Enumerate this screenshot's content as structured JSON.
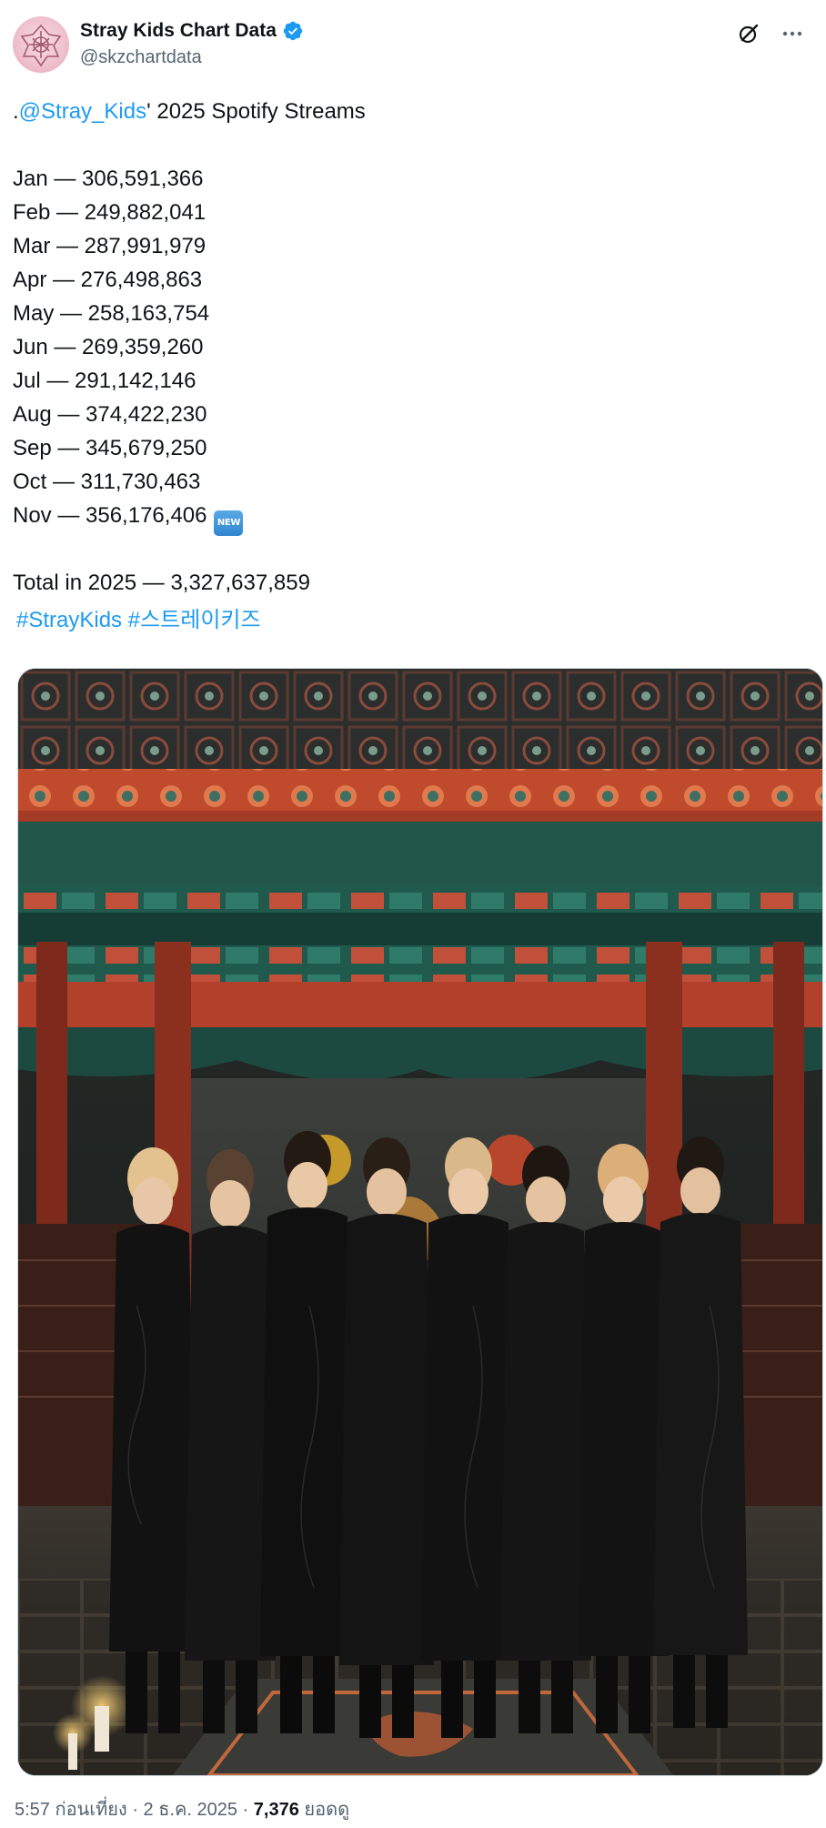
{
  "author": {
    "name": "Stray Kids Chart Data",
    "handle": "@skzchartdata"
  },
  "tweet": {
    "intro_prefix": ".",
    "mention": "@Stray_Kids",
    "intro_suffix": "' 2025 Spotify Streams",
    "months": [
      {
        "text": "Jan — 306,591,366"
      },
      {
        "text": "Feb — 249,882,041"
      },
      {
        "text": "Mar — 287,991,979"
      },
      {
        "text": "Apr — 276,498,863"
      },
      {
        "text": "May — 258,163,754"
      },
      {
        "text": "Jun — 269,359,260"
      },
      {
        "text": "Jul — 291,142,146"
      },
      {
        "text": "Aug — 374,422,230"
      },
      {
        "text": "Sep — 345,679,250"
      },
      {
        "text": "Oct — 311,730,463"
      },
      {
        "text": "Nov — 356,176,406"
      }
    ],
    "new_badge": "NEW",
    "total": "Total in 2025 — 3,327,637,859",
    "hashtags": [
      "#StrayKids",
      "#스트레이키즈"
    ]
  },
  "meta": {
    "time_date": "5:57 ก่อนเที่ยง · 2 ธ.ค. 2025 · ",
    "views_count": "7,376",
    "views_label": " ยอดดู"
  },
  "icons": {
    "verified": "verified-badge-icon",
    "grok": "grok-icon",
    "more": "more-icon"
  },
  "colors": {
    "link": "#1d9bf0",
    "verified": "#1d9bf0",
    "secondary_text": "#536471",
    "primary_text": "#0f1419"
  }
}
